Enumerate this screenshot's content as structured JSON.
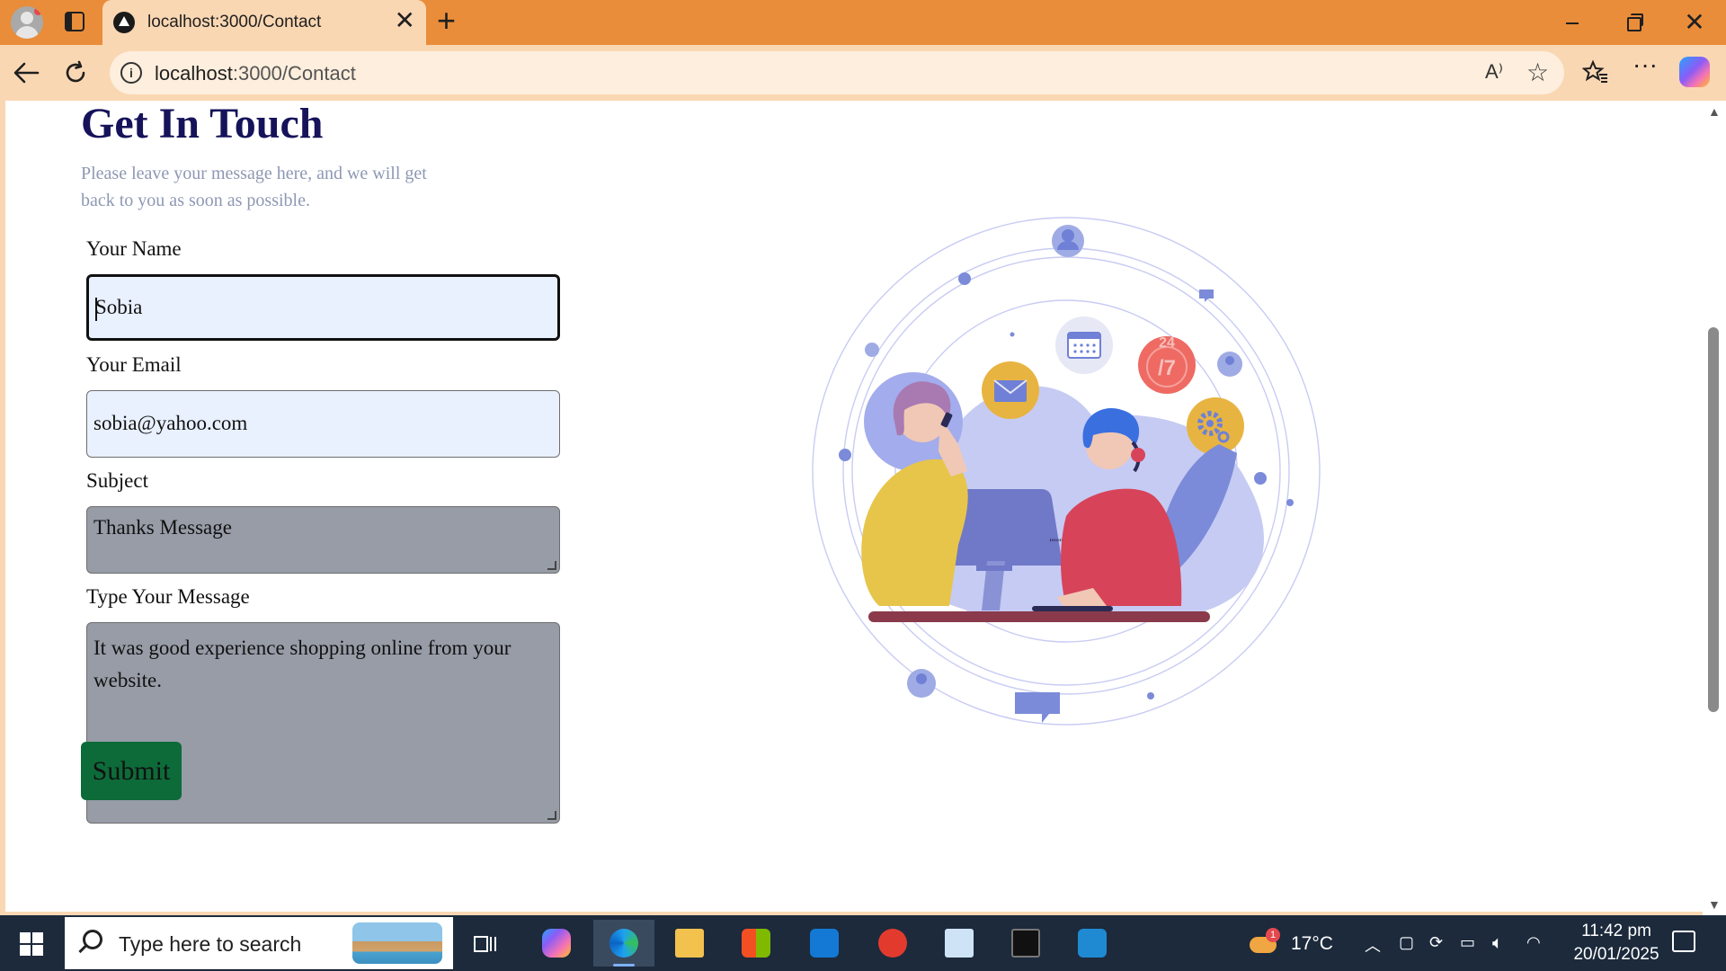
{
  "browser": {
    "tab_title": "localhost:3000/Contact",
    "tab_close": "✕",
    "new_tab": "+",
    "url_host": "localhost",
    "url_path": ":3000/Contact",
    "read_aloud": "A⁾",
    "window_close": "✕"
  },
  "page": {
    "heading": "Get In Touch",
    "subtext": "Please leave your message here, and we will get back to you as soon as possible.",
    "form": {
      "name_label": "Your Name",
      "name_value": "Sobia",
      "email_label": "Your Email",
      "email_value": "sobia@yahoo.com",
      "subject_label": "Subject",
      "subject_value": "Thanks Message",
      "message_label": "Type Your Message",
      "message_value": "It was good experience shopping online from your website.",
      "submit_label": "Submit"
    },
    "illustration": {
      "badge_24": "24",
      "badge_7": "/7",
      "keyboard_marks_left": "\"\"\"\"",
      "keyboard_marks_right": "\"\"\"\""
    }
  },
  "taskbar": {
    "search_placeholder": "Type here to search",
    "weather_temp": "17°C",
    "weather_badge": "1",
    "time": "11:42 pm",
    "date": "20/01/2025"
  },
  "colors": {
    "chrome_orange": "#E98D3A",
    "chrome_light": "#FAD7B3",
    "heading": "#16135a",
    "submit_bg": "#0d6b39",
    "input_light": "#E9F0FE",
    "input_grey": "#979ca7"
  },
  "icons": [
    "profile-icon",
    "tabs-icon",
    "close-icon",
    "plus-icon",
    "back-icon",
    "refresh-icon",
    "info-icon",
    "read-aloud-icon",
    "favorite-icon",
    "favorites-bar-icon",
    "more-icon",
    "copilot-icon",
    "windows-icon",
    "search-icon",
    "task-view-icon",
    "edge-icon",
    "file-explorer-icon",
    "store-icon",
    "outlook-icon",
    "wps-icon",
    "notepad-icon",
    "terminal-icon",
    "vscode-icon",
    "weather-icon",
    "chevron-up-icon",
    "speaker-icon",
    "wifi-icon",
    "battery-icon",
    "notification-icon"
  ]
}
